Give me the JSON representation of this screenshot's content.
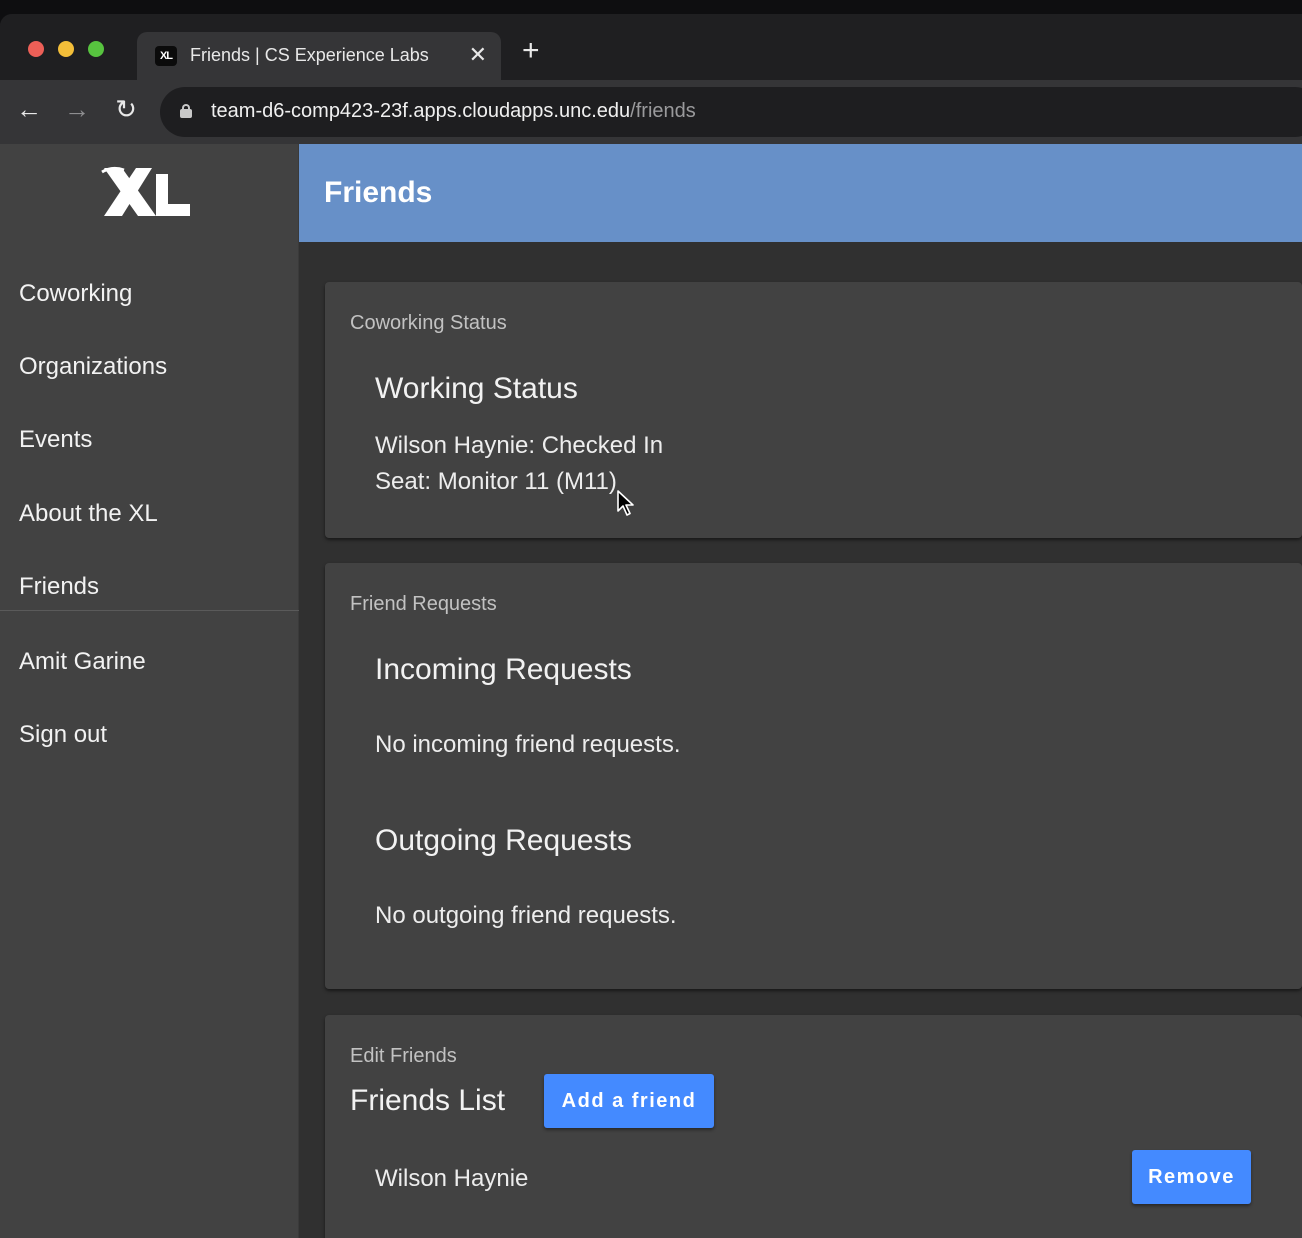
{
  "browser": {
    "tab_title": "Friends | CS Experience Labs",
    "tab_favicon": "XL",
    "tab_close_glyph": "✕",
    "new_tab_glyph": "+",
    "back_glyph": "←",
    "forward_glyph": "→",
    "reload_glyph": "↻",
    "url_host": "team-d6-comp423-23f.apps.cloudapps.unc.edu",
    "url_path": "/friends"
  },
  "sidebar": {
    "logo": "xl-logo",
    "items": [
      {
        "label": "Coworking"
      },
      {
        "label": "Organizations"
      },
      {
        "label": "Events"
      },
      {
        "label": "About the XL"
      },
      {
        "label": "Friends"
      }
    ],
    "account_items": [
      {
        "label": "Amit Garine"
      },
      {
        "label": "Sign out"
      }
    ]
  },
  "header": {
    "title": "Friends",
    "color": "#6790c8"
  },
  "coworking_card": {
    "subtitle": "Coworking Status",
    "heading": "Working Status",
    "status_line": "Wilson Haynie: Checked In",
    "seat_line": "Seat: Monitor 11 (M11)"
  },
  "requests_card": {
    "subtitle": "Friend Requests",
    "incoming_heading": "Incoming Requests",
    "incoming_empty": "No incoming friend requests.",
    "outgoing_heading": "Outgoing Requests",
    "outgoing_empty": "No outgoing friend requests."
  },
  "friends_card": {
    "subtitle": "Edit Friends",
    "heading": "Friends List",
    "add_button": "Add a friend",
    "friends": [
      {
        "name": "Wilson Haynie",
        "remove_label": "Remove"
      }
    ]
  },
  "colors": {
    "accent_button": "#448aff",
    "sidebar_bg": "#424242",
    "content_bg": "#303030"
  }
}
